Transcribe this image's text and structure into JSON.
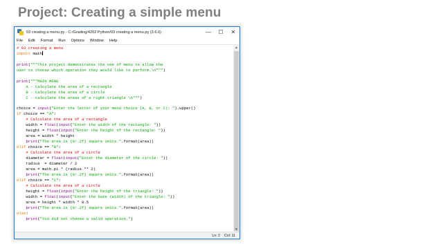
{
  "slide": {
    "title": "Project: Creating a simple menu"
  },
  "window": {
    "title": "03 creating a menu.py - C:/Grading/4202 Python/03 creating a menu.py (3.6.6)",
    "controls": {
      "minimize": "—",
      "maximize": "☐",
      "close": "✕"
    }
  },
  "menu": [
    "File",
    "Edit",
    "Format",
    "Run",
    "Options",
    "Window",
    "Help"
  ],
  "code": {
    "l01": "# 03 creating a menu",
    "l02_kw": "import",
    "l02_rest": " math",
    "l04_fn": "print",
    "l04_rest": "(",
    "l04_str": "\"\"\"This project demonstrates the use of menu to allow the",
    "l05_str": "user to choose which operation they would like to perform.\\n\"\"\"",
    "l05_end": ")",
    "l07_fn": "print",
    "l07_rest": "(",
    "l07_str": "\"\"\"MAIN MENU",
    "l08_str": "    A - Calculate the area of a rectangle",
    "l09_str": "    B - Calculate the area of a circle",
    "l10_str": "    C - calculate the areas of a right triangle \\n\"\"\"",
    "l10_end": ")",
    "l12_a": "choice = ",
    "l12_fn": "input",
    "l12_b": "(",
    "l12_str": "\"Enter the letter of your menu choice (A, B, or C): \"",
    "l12_c": ").upper()",
    "l13_kw": "if",
    "l13_a": " choice == ",
    "l13_str": "\"A\"",
    "l13_b": ":",
    "l14": "    # Calculate the area of a rectangle",
    "l15_a": "    width = ",
    "l15_fn1": "float",
    "l15_b": "(",
    "l15_fn2": "input",
    "l15_c": "(",
    "l15_str": "\"Enter the width of the rectangle: \"",
    "l15_d": "))",
    "l16_a": "    height = ",
    "l16_fn1": "float",
    "l16_b": "(",
    "l16_fn2": "input",
    "l16_c": "(",
    "l16_str": "\"Enter the height of the rectangle: \"",
    "l16_d": "))",
    "l17": "    area = width * height",
    "l18_a": "    ",
    "l18_fn": "print",
    "l18_b": "(",
    "l18_str": "\"The area is {0:.2f} square units.\"",
    "l18_c": ".format(area))",
    "l19_kw": "elif",
    "l19_a": " choice == ",
    "l19_str": "\"B\"",
    "l19_b": ":",
    "l20": "    # Calculate the area of a circle",
    "l21_a": "    diameter = ",
    "l21_fn1": "float",
    "l21_b": "(",
    "l21_fn2": "input",
    "l21_c": "(",
    "l21_str": "\"Enter the diameter of the circle: \"",
    "l21_d": "))",
    "l22": "    radius  = diameter / 2",
    "l23": "    area = math.pi * (radius ** 2)",
    "l24_a": "    ",
    "l24_fn": "print",
    "l24_b": "(",
    "l24_str": "\"The area is {0:.2f} square units.\"",
    "l24_c": ".format(area))",
    "l25_kw": "elif",
    "l25_a": " choice == ",
    "l25_str": "\"C\"",
    "l25_b": ":",
    "l26": "    # Calculate the area of a circle",
    "l27_a": "    height = ",
    "l27_fn1": "float",
    "l27_b": "(",
    "l27_fn2": "input",
    "l27_c": "(",
    "l27_str": "\"Enter the height of the triangle: \"",
    "l27_d": "))",
    "l28_a": "    width = ",
    "l28_fn1": "float",
    "l28_b": "(",
    "l28_fn2": "input",
    "l28_c": "(",
    "l28_str": "\"Enter the base (width) of the triangle: \"",
    "l28_d": "))",
    "l29": "    area = height * width * 0.5",
    "l30_a": "    ",
    "l30_fn": "print",
    "l30_b": "(",
    "l30_str": "\"The area is {0:.2f} square units.\"",
    "l30_c": ".format(area))",
    "l31_kw": "else",
    "l31_b": ":",
    "l32_a": "    ",
    "l32_fn": "print",
    "l32_b": "(",
    "l32_str": "\"You did not choose a valid operation.\"",
    "l32_c": ")"
  },
  "status": {
    "line": "Ln: 2",
    "col": "Col: 11"
  },
  "colors": {
    "keyword": "#ff7700",
    "string": "#00aa00",
    "comment": "#dd0000",
    "builtin": "#900090",
    "window_border": "#1a7fd4"
  }
}
